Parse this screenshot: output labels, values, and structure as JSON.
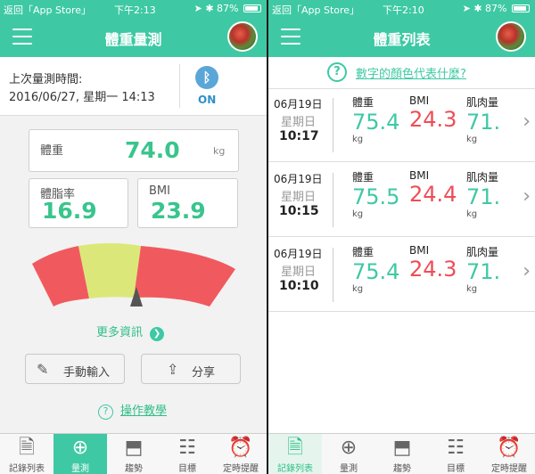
{
  "left": {
    "status": {
      "back": "返回「App Store」",
      "time": "下午2:13",
      "battery": "87%"
    },
    "nav": {
      "title": "體重量測"
    },
    "last": {
      "label": "上次量測時間:",
      "value": "2016/06/27, 星期一 14:13",
      "bt_status": "ON"
    },
    "metrics": {
      "weight": {
        "label": "體重",
        "value": "74.0",
        "unit": "kg"
      },
      "bodyfat": {
        "label": "體脂率",
        "value": "16.9"
      },
      "bmi": {
        "label": "BMI",
        "value": "23.9"
      }
    },
    "gauge": {
      "colors": [
        "#f05a5f",
        "#dbe879",
        "#f05a5f"
      ],
      "pointer_fraction": 0.5
    },
    "more_info": "更多資訊",
    "buttons": {
      "manual": "手動輸入",
      "share": "分享"
    },
    "help": "操作教學",
    "tabs": [
      {
        "label": "記錄列表",
        "icon": "document-icon"
      },
      {
        "label": "量測",
        "icon": "plus-icon"
      },
      {
        "label": "趨勢",
        "icon": "trend-icon"
      },
      {
        "label": "目標",
        "icon": "sliders-icon"
      },
      {
        "label": "定時提醒",
        "icon": "alarm-icon"
      }
    ]
  },
  "right": {
    "status": {
      "back": "返回「App Store」",
      "time": "下午2:10",
      "battery": "87%"
    },
    "nav": {
      "title": "體重列表"
    },
    "question": "數字的顏色代表什麼?",
    "col_labels": {
      "weight": "體重",
      "bmi": "BMI",
      "muscle": "肌肉量",
      "unit": "kg"
    },
    "records": [
      {
        "date": "06月19日",
        "weekday": "星期日",
        "time": "10:17",
        "weight": "75.4",
        "bmi": "24.3",
        "muscle": "71."
      },
      {
        "date": "06月19日",
        "weekday": "星期日",
        "time": "10:15",
        "weight": "75.5",
        "bmi": "24.4",
        "muscle": "71."
      },
      {
        "date": "06月19日",
        "weekday": "星期日",
        "time": "10:10",
        "weight": "75.4",
        "bmi": "24.3",
        "muscle": "71."
      }
    ],
    "tabs": [
      {
        "label": "記錄列表",
        "icon": "document-icon"
      },
      {
        "label": "量測",
        "icon": "plus-icon"
      },
      {
        "label": "趨勢",
        "icon": "trend-icon"
      },
      {
        "label": "目標",
        "icon": "sliders-icon"
      },
      {
        "label": "定時提醒",
        "icon": "alarm-icon"
      }
    ]
  }
}
